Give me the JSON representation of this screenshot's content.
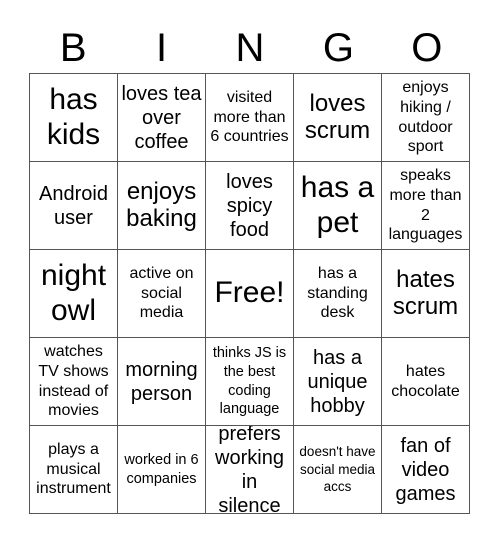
{
  "title_letters": [
    "B",
    "I",
    "N",
    "G",
    "O"
  ],
  "board": {
    "rows": [
      [
        {
          "text": "has kids",
          "size": "s-xl"
        },
        {
          "text": "loves tea over coffee",
          "size": "s-m"
        },
        {
          "text": "visited more than 6 countries",
          "size": "s-s"
        },
        {
          "text": "loves scrum",
          "size": "s-l"
        },
        {
          "text": "enjoys hiking / outdoor sport",
          "size": "s-s"
        }
      ],
      [
        {
          "text": "Android user",
          "size": "s-m"
        },
        {
          "text": "enjoys baking",
          "size": "s-l"
        },
        {
          "text": "loves spicy food",
          "size": "s-m"
        },
        {
          "text": "has a pet",
          "size": "s-xl"
        },
        {
          "text": "speaks more than 2 languages",
          "size": "s-s"
        }
      ],
      [
        {
          "text": "night owl",
          "size": "s-xl"
        },
        {
          "text": "active on social media",
          "size": "s-s"
        },
        {
          "text": "Free!",
          "size": "s-xl"
        },
        {
          "text": "has a standing desk",
          "size": "s-s"
        },
        {
          "text": "hates scrum",
          "size": "s-l"
        }
      ],
      [
        {
          "text": "watches TV shows instead of movies",
          "size": "s-s"
        },
        {
          "text": "morning person",
          "size": "s-m"
        },
        {
          "text": "thinks JS is the best coding language",
          "size": "s-xs"
        },
        {
          "text": "has a unique hobby",
          "size": "s-m"
        },
        {
          "text": "hates chocolate",
          "size": "s-s"
        }
      ],
      [
        {
          "text": "plays a musical instrument",
          "size": "s-s"
        },
        {
          "text": "worked in 6 companies",
          "size": "s-xs"
        },
        {
          "text": "prefers working in silence",
          "size": "s-m"
        },
        {
          "text": "doesn't have social media accs",
          "size": "s-xxs"
        },
        {
          "text": "fan of video games",
          "size": "s-m"
        }
      ]
    ]
  }
}
